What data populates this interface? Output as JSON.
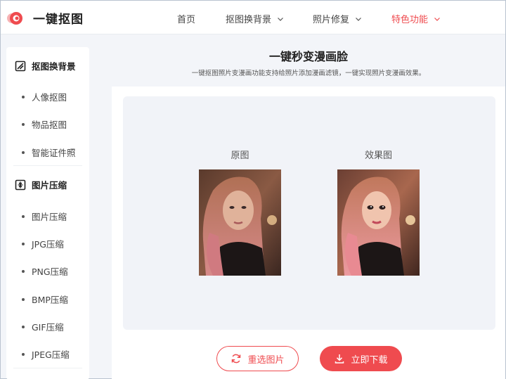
{
  "brand": {
    "title": "一键抠图",
    "accent": "#ef4b4f"
  },
  "nav": {
    "items": [
      {
        "label": "首页"
      },
      {
        "label": "抠图换背景"
      },
      {
        "label": "照片修复"
      },
      {
        "label": "特色功能"
      }
    ]
  },
  "sidebar": {
    "groups": [
      {
        "title": "抠图换背景",
        "icon": "image-slash-icon",
        "items": [
          "人像抠图",
          "物品抠图",
          "智能证件照"
        ]
      },
      {
        "title": "图片压缩",
        "icon": "compress-icon",
        "items": [
          "图片压缩",
          "JPG压缩",
          "PNG压缩",
          "BMP压缩",
          "GIF压缩",
          "JPEG压缩"
        ]
      }
    ]
  },
  "main": {
    "title": "一键秒变漫画脸",
    "subtitle": "一键抠图照片变漫画功能支持给照片添加漫画滤镜，一键实现照片变漫画效果。",
    "original_label": "原图",
    "result_label": "效果图",
    "reselect_label": "重选图片",
    "download_label": "立即下载"
  }
}
